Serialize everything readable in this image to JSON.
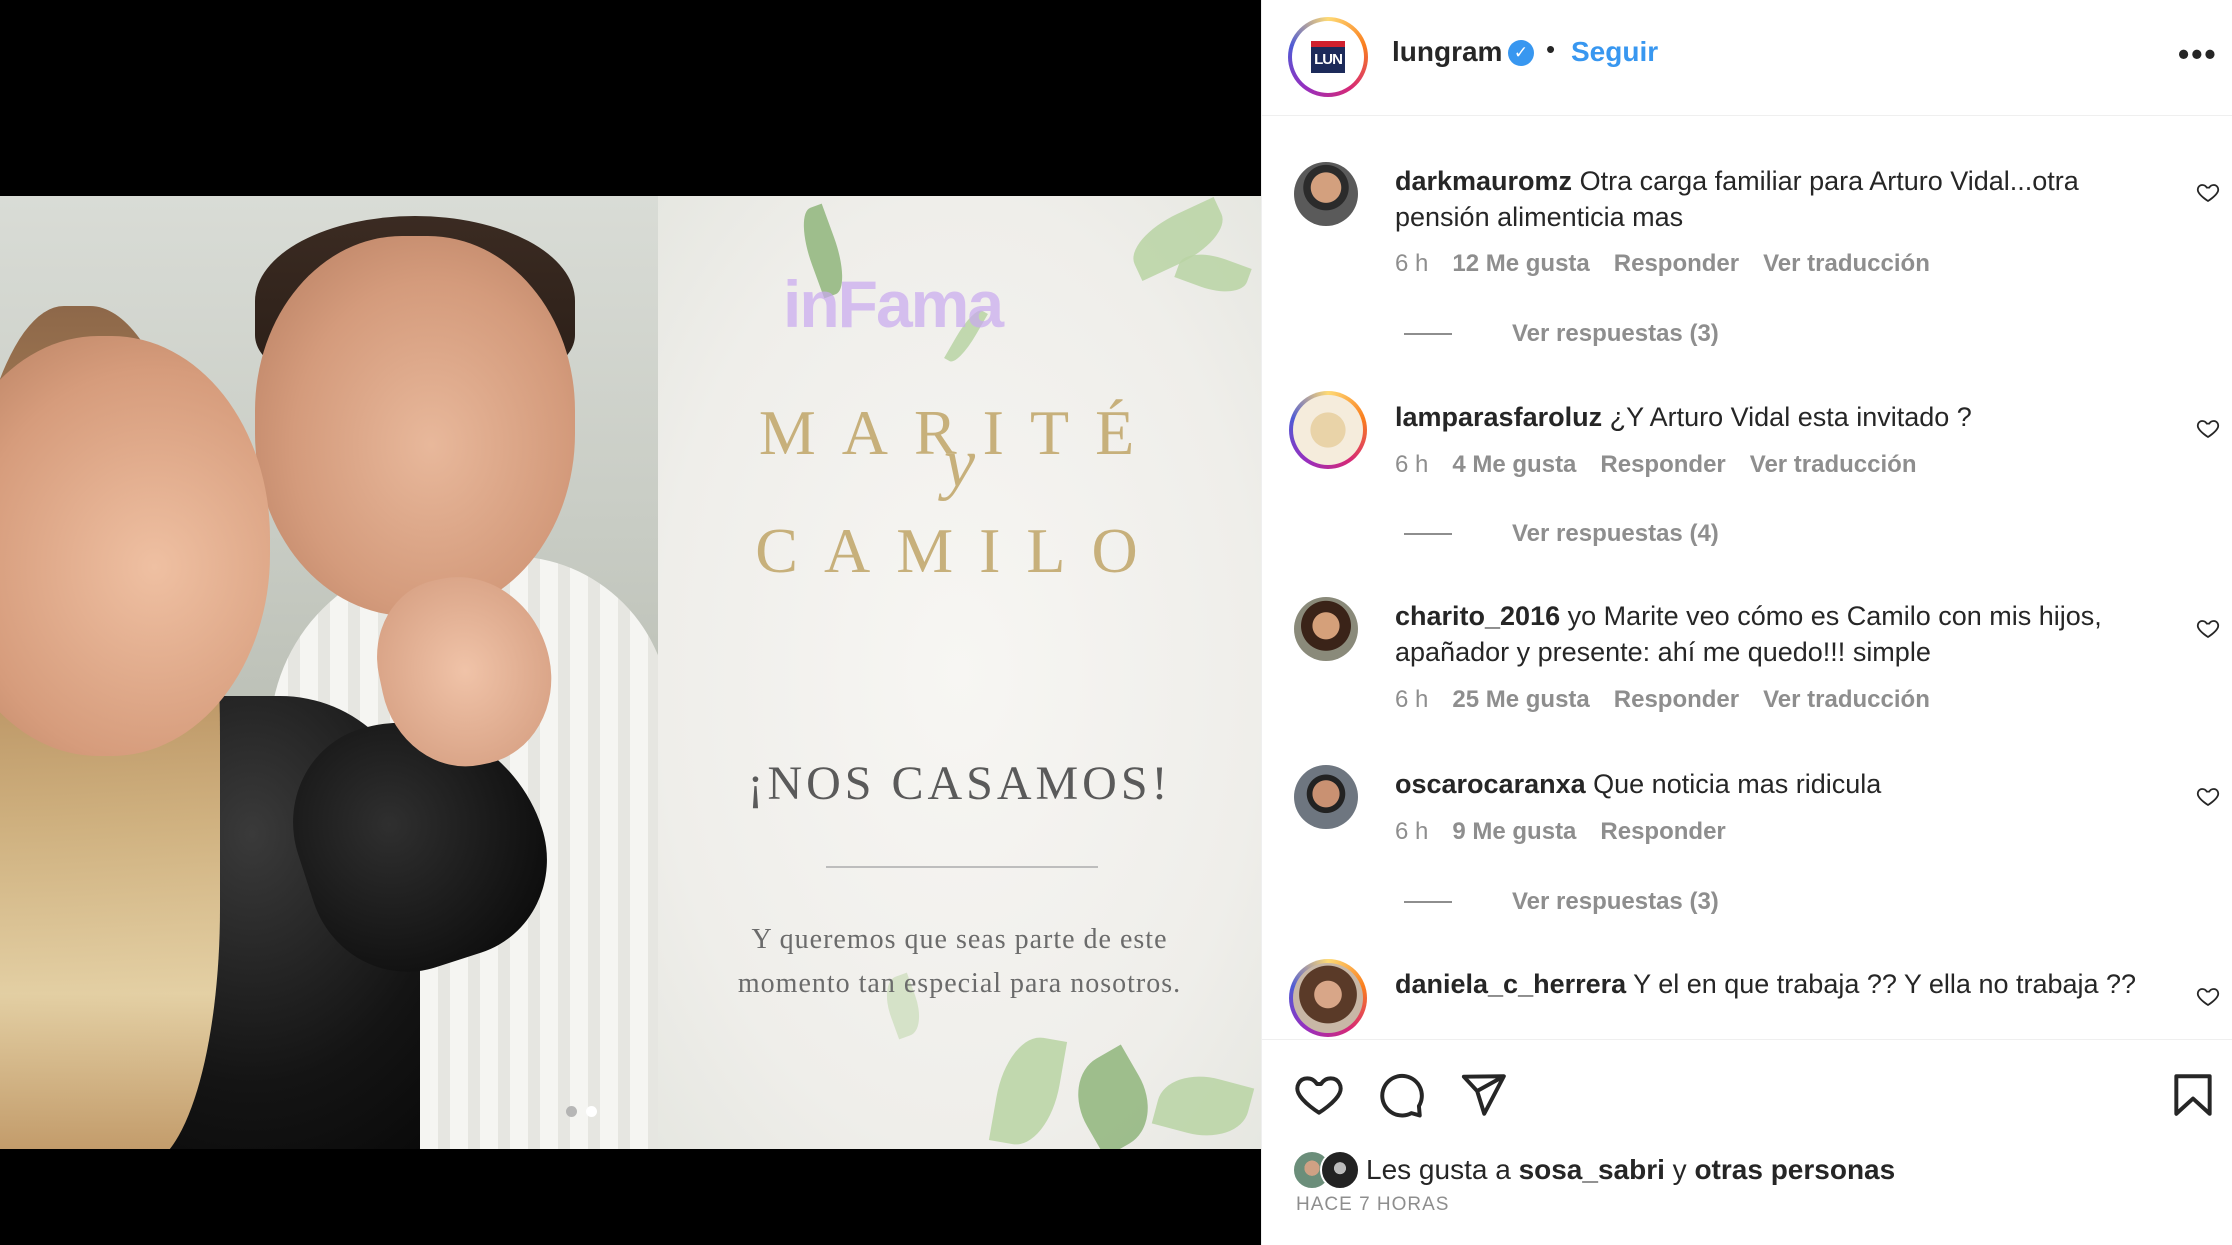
{
  "post": {
    "username": "lungram",
    "follow_label": "Seguir",
    "separator": "•",
    "more_label": "•••",
    "logo_text": "LUN"
  },
  "image_card": {
    "watermark": "inFama",
    "name_top": "MARITÉ",
    "name_y": "y",
    "name_bottom": "CAMILO",
    "title": "¡NOS CASAMOS!",
    "subtitle_line1": "Y queremos que seas parte de este",
    "subtitle_line2": "momento tan especial para nosotros.",
    "carousel_count": 2,
    "carousel_active": 2
  },
  "comments": [
    {
      "user": "darkmauromz",
      "text": "Otra carga familiar para Arturo Vidal...otra pensión alimenticia mas",
      "time": "6 h",
      "likes": "12 Me gusta",
      "reply": "Responder",
      "translate": "Ver traducción",
      "view_replies": "Ver respuestas (3)"
    },
    {
      "user": "lamparasfaroluz",
      "text": "¿Y Arturo Vidal esta invitado ?",
      "time": "6 h",
      "likes": "4 Me gusta",
      "reply": "Responder",
      "translate": "Ver traducción",
      "view_replies": "Ver respuestas (4)"
    },
    {
      "user": "charito_2016",
      "text": "yo Marite veo cómo es Camilo con mis hijos, apañador y presente: ahí me quedo!!! simple",
      "time": "6 h",
      "likes": "25 Me gusta",
      "reply": "Responder",
      "translate": "Ver traducción"
    },
    {
      "user": "oscarocaranxa",
      "text": "Que noticia mas ridicula",
      "time": "6 h",
      "likes": "9 Me gusta",
      "reply": "Responder",
      "view_replies": "Ver respuestas (3)"
    },
    {
      "user": "daniela_c_herrera",
      "text": "Y el en que trabaja ?? Y ella no trabaja ??"
    }
  ],
  "footer": {
    "likes_prefix": "Les gusta a",
    "likes_user": "sosa_sabri",
    "likes_and": "y",
    "likes_others": "otras personas",
    "time_ago": "HACE 7 HORAS"
  },
  "icons": {
    "like": "heart-icon",
    "comment": "comment-icon",
    "share": "send-icon",
    "save": "bookmark-icon",
    "verified": "verified-badge-icon",
    "more": "more-options-icon"
  },
  "colors": {
    "accent": "#3897f0",
    "muted": "#8e8e8e",
    "text": "#262626"
  }
}
